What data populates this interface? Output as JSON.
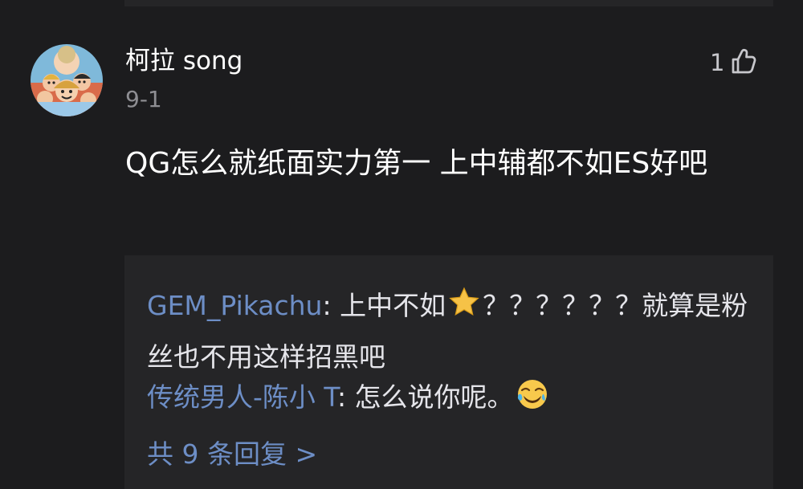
{
  "comment": {
    "username": "柯拉 song",
    "date": "9-1",
    "like_count": "1",
    "text": "QG怎么就纸面实力第一  上中辅都不如ES好吧"
  },
  "replies": [
    {
      "user": "GEM_Pikachu",
      "separator": ": ",
      "text_before_emoji": "上中不如",
      "emoji": "star-emoji",
      "text_after_emoji": "？？？？？？就算是粉丝也不用这样招黑吧"
    },
    {
      "user": "传统男人-陈小 T",
      "separator": ": ",
      "text": "怎么说你呢。",
      "emoji": "laughing-tears-emoji"
    }
  ],
  "more_replies": "共 9 条回复 >",
  "colors": {
    "panel_background": "#1c1c1e",
    "reply_background": "#252527",
    "reply_username": "#6d8ec6",
    "secondary_text": "#8e8e93"
  },
  "icons": {
    "like": "thumbs-up-icon",
    "avatar": "anime-group-avatar"
  }
}
